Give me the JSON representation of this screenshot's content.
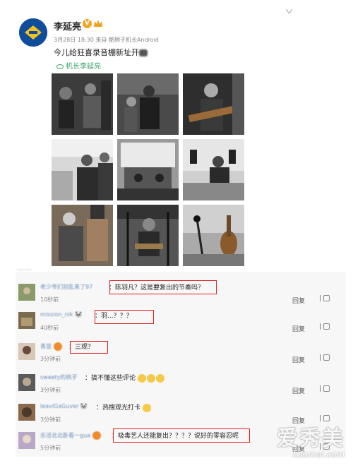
{
  "post": {
    "author": "李延亮",
    "verified_mark": "V",
    "meta": "3月28日 18:30 来自 酷狮子机长Android",
    "text": "今儿给狂喜录音棚新址开",
    "mention": "机长李延亮"
  },
  "comment_header": "········",
  "comments": [
    {
      "user": "老少爷们别乱来了97",
      "text": "陈羽凡？这是要复出的节奏吗？",
      "time": "10秒前",
      "reply": "回复"
    },
    {
      "user": "mission_nik",
      "text": "羽...？？？",
      "time": "40秒前",
      "reply": "回复"
    },
    {
      "user": "青苗",
      "text": "三观？",
      "time": "3分钟前",
      "reply": "回复"
    },
    {
      "user": "sweety的桃子",
      "text": "搞不懂这些评论",
      "time": "3分钟前",
      "reply": "回复"
    },
    {
      "user": "leaviGaGuver",
      "text": "热搜观光打卡",
      "time": "3分钟前",
      "reply": "回复"
    },
    {
      "user": "乐活北北卧看一gua",
      "text": "吸毒艺人还能复出？？？？说好的零容忍呢",
      "time": "5分钟前",
      "reply": "回复"
    }
  ],
  "watermark": {
    "main": "爱秀美",
    "sub": "ixiumei.com"
  },
  "colors": {
    "highlight": "#e02020",
    "link": "#3aa06a",
    "username": "#6a8fb8"
  }
}
